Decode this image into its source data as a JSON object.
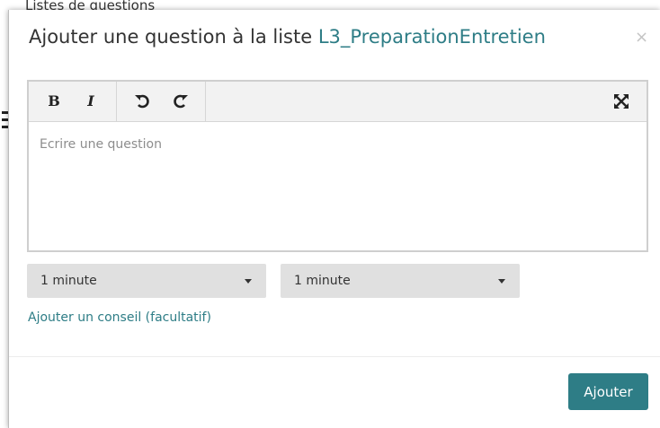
{
  "background": {
    "heading": "Listes de questions"
  },
  "modal": {
    "title_prefix": "Ajouter une question à la liste ",
    "list_name": "L3_PreparationEntretien",
    "close_label": "×",
    "accent_color": "#2e7d86"
  },
  "editor": {
    "toolbar": {
      "bold_label": "B",
      "italic_label": "I",
      "undo_icon": "undo-icon",
      "redo_icon": "redo-icon",
      "fullscreen_icon": "fullscreen-icon"
    },
    "placeholder": "Ecrire une question"
  },
  "selects": [
    {
      "value": "1 minute"
    },
    {
      "value": "1 minute"
    }
  ],
  "advice_link": "Ajouter un conseil (facultatif)",
  "submit_label": "Ajouter"
}
